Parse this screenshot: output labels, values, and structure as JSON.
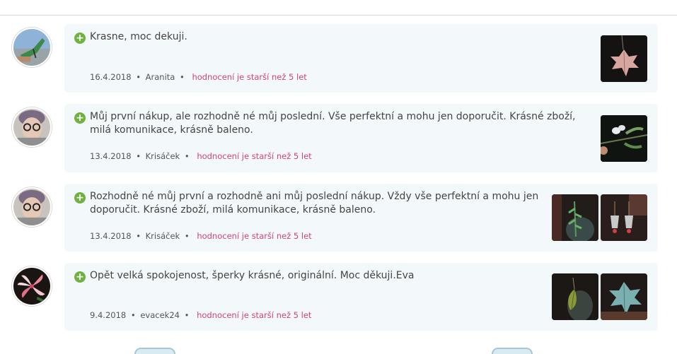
{
  "reviews": [
    {
      "text": "Krasne, moc dekuji.",
      "date": "16.4.2018",
      "author": "Aranita",
      "age_note": "hodnocení je starší než 5 let",
      "avatar": "avatar-aranita",
      "thumbs": [
        "maple-leaf-pendant-photo"
      ]
    },
    {
      "text": "Můj první nákup, ale rozhodně né můj poslední. Vše perfektní a mohu jen doporučit. Krásné zboží, milá komunikace, krásně baleno.",
      "date": "13.4.2018",
      "author": "Krisáček",
      "age_note": "hodnocení je starší než 5 let",
      "avatar": "avatar-krisacek",
      "thumbs": [
        "mistletoe-hairpin-photo"
      ]
    },
    {
      "text": "Rozhodně né můj první a rozhodně ani můj poslední nákup. Vždy vše perfektní a mohu jen doporučit. Krásné zboží, milá komunikace, krásně baleno.",
      "date": "13.4.2018",
      "author": "Krisáček",
      "age_note": "hodnocení je starší než 5 let",
      "avatar": "avatar-krisacek",
      "thumbs": [
        "fern-pendant-photo",
        "bead-earrings-photo"
      ]
    },
    {
      "text": "Opět velká spokojenost, šperky krásné, originální. Moc děkuji.Eva",
      "date": "9.4.2018",
      "author": "evacek24",
      "age_note": "hodnocení je starší než 5 let",
      "avatar": "avatar-evacek24",
      "thumbs": [
        "leaf-pendant-photo",
        "turquoise-leaf-photo"
      ]
    }
  ],
  "separator": "•",
  "colors": {
    "accent_pink": "#d1437c",
    "plus_green": "#6fb23f",
    "card_bg": "#f3f8fb"
  }
}
